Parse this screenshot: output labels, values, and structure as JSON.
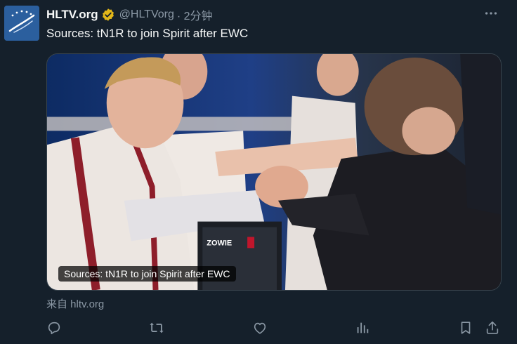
{
  "tweet": {
    "author_name": "HLTV.org",
    "author_handle": "@HLTVorg",
    "time": "· 2分钟",
    "text": "Sources: tN1R to join Spirit after EWC"
  },
  "card": {
    "title": "Sources: tN1R to join Spirit after EWC",
    "source": "来自 hltv.org",
    "photo_text": {
      "monitor_brand": "ZOWIE"
    }
  },
  "colors": {
    "background": "#15202b",
    "text_primary": "#f7f9f9",
    "text_secondary": "#8b98a5",
    "verified_gold": "#e2b719",
    "avatar_blue": "#2b5f9e"
  },
  "icons": [
    "verified-badge-icon",
    "more-options-icon",
    "reply-icon",
    "retweet-icon",
    "like-icon",
    "analytics-icon",
    "bookmark-icon",
    "share-icon"
  ]
}
